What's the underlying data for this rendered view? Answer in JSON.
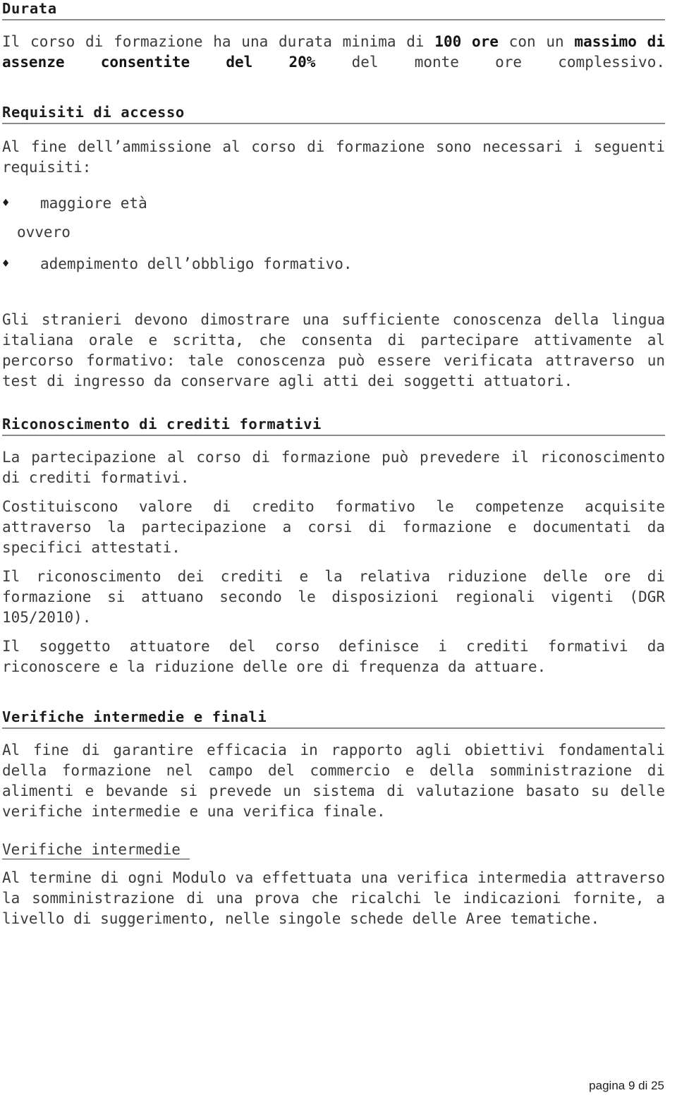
{
  "document": {
    "page_footer": "pagina 9 di 25",
    "bullet_glyph": "♦",
    "rule_color": "#8a8a8a",
    "text_color": "#3b3b3b"
  },
  "sections": {
    "durata": {
      "heading": "Durata",
      "paragraph_parts": {
        "p1_a": "Il corso di formazione ha una durata minima di ",
        "p1_b": "100 ore",
        "p1_c": " con un ",
        "p1_d": "massimo di assenze consentite del 20%",
        "p1_e": " del monte ore complessivo."
      }
    },
    "requisiti": {
      "heading": "Requisiti di accesso",
      "intro": "Al fine dell’ammissione al corso di formazione sono necessari i seguenti requisiti:",
      "bullets": [
        "maggiore età",
        "adempimento dell’obbligo formativo."
      ],
      "connector": "ovvero",
      "stranieri": "Gli stranieri devono dimostrare una sufficiente conoscenza della lingua italiana orale e scritta, che consenta di partecipare attivamente al percorso formativo: tale conoscenza può essere verificata attraverso un test di ingresso da conservare agli atti dei soggetti attuatori."
    },
    "crediti": {
      "heading": "Riconoscimento di crediti formativi",
      "paragraphs": [
        "La partecipazione al corso di formazione può prevedere il riconoscimento di crediti formativi.",
        "Costituiscono valore di credito formativo le competenze acquisite attraverso la partecipazione a corsi di formazione e documentati da specifici attestati.",
        "Il riconoscimento dei crediti e la relativa riduzione delle ore di formazione si attuano secondo le disposizioni regionali vigenti (DGR 105/2010).",
        "Il soggetto attuatore del corso definisce i crediti formativi da riconoscere e la riduzione delle ore di frequenza da attuare."
      ]
    },
    "verifiche": {
      "heading": "Verifiche intermedie e finali",
      "intro": "Al fine di garantire efficacia in rapporto agli obiettivi fondamentali della formazione nel campo del commercio e della somministrazione di alimenti e bevande si prevede un sistema di valutazione basato su delle verifiche intermedie e una verifica finale.",
      "subheading": "Verifiche intermedie ",
      "body": "Al termine di ogni Modulo va effettuata una verifica intermedia attraverso la somministrazione di una prova che ricalchi le indicazioni fornite, a livello di suggerimento, nelle singole schede delle Aree tematiche."
    }
  }
}
